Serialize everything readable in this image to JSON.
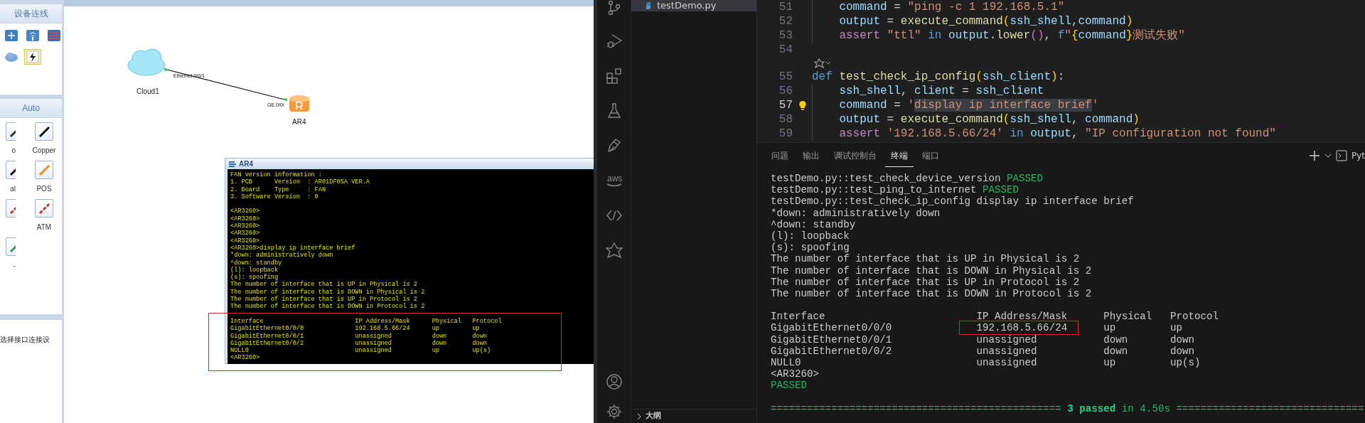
{
  "ensp": {
    "device_panel": {
      "title": "设备连线",
      "devices": [
        {
          "kind": "switch",
          "selected": false
        },
        {
          "kind": "wireless",
          "selected": false
        },
        {
          "kind": "firewall",
          "selected": false
        },
        {
          "kind": "cloud",
          "selected": false
        },
        {
          "kind": "bolt",
          "selected": true
        }
      ]
    },
    "links_panel": {
      "title": "Auto",
      "links": [
        {
          "kind": "auto",
          "label": "o"
        },
        {
          "kind": "copper",
          "label": "Copper"
        },
        {
          "kind": "serial",
          "label": "al"
        },
        {
          "kind": "pos",
          "label": "POS"
        },
        {
          "kind": "e1"
        },
        {
          "kind": "atm",
          "label": "ATM"
        },
        {
          "kind": "ctl",
          "label": "-"
        }
      ]
    },
    "hint": "选择接口连接设",
    "topology": {
      "nodes": [
        {
          "kind": "cloud",
          "label": "Cloud1"
        },
        {
          "kind": "router",
          "label": "AR4"
        }
      ],
      "link": {
        "from_port": "Ethernet 0/0/1",
        "to_port": "GE 0/0/"
      }
    },
    "console": {
      "title": "AR4",
      "lines": [
        {
          "kind": "text",
          "t": "FAN version information :"
        },
        {
          "kind": "text",
          "t": "1. PCB      Version  : AR01DF05A VER.A"
        },
        {
          "kind": "text",
          "t": "2. Board    Type     : FAN"
        },
        {
          "kind": "text",
          "t": "3. Software Version  : 0"
        },
        {
          "kind": "blank"
        },
        {
          "kind": "text",
          "t": "<AR3260>"
        },
        {
          "kind": "text",
          "t": "<AR3260>"
        },
        {
          "kind": "text",
          "t": "<AR3260>"
        },
        {
          "kind": "text",
          "t": "<AR3260>"
        },
        {
          "kind": "text",
          "t": "<AR3260>"
        },
        {
          "kind": "text",
          "t": "<AR3260>display ip interface brief"
        },
        {
          "kind": "text",
          "t": "*down: administratively down"
        },
        {
          "kind": "text",
          "t": "^down: standby"
        },
        {
          "kind": "text",
          "t": "(l): loopback"
        },
        {
          "kind": "text",
          "t": "(s): spoofing"
        },
        {
          "kind": "text",
          "t": "The number of interface that is UP in Physical is 2"
        },
        {
          "kind": "text",
          "t": "The number of interface that is DOWN in Physical is 2"
        },
        {
          "kind": "text",
          "t": "The number of interface that is UP in Protocol is 2"
        },
        {
          "kind": "text",
          "t": "The number of interface that is DOWN in Protocol is 2"
        },
        {
          "kind": "blank"
        }
      ],
      "table": {
        "highlighted": true,
        "rows": [
          [
            "Interface",
            "IP Address/Mask",
            "Physical",
            "Protocol"
          ],
          [
            "GigabitEthernet0/0/0",
            "192.168.5.66/24",
            "up",
            "up"
          ],
          [
            "GigabitEthernet0/0/1",
            "unassigned",
            "down",
            "down"
          ],
          [
            "GigabitEthernet0/0/2",
            "unassigned",
            "down",
            "down"
          ],
          [
            "NULL0",
            "unassigned",
            "up",
            "up(s)"
          ]
        ]
      },
      "prompt": "<AR3260>"
    }
  },
  "vscode": {
    "activity_bar": [
      {
        "kind": "source-control"
      },
      {
        "kind": "run-debug"
      },
      {
        "kind": "extensions"
      },
      {
        "kind": "testing"
      },
      {
        "kind": "plugin"
      },
      {
        "kind": "aws",
        "label": "aws"
      },
      {
        "kind": "code-link"
      },
      {
        "kind": "star"
      },
      {
        "kind": "account"
      },
      {
        "kind": "settings"
      }
    ],
    "explorer": {
      "files": [
        {
          "name": "testDemo.py",
          "selected": true
        }
      ],
      "outline": {
        "title": "大纲",
        "expanded": false
      }
    },
    "editor": {
      "lines": [
        {
          "number": "51",
          "indented": true,
          "tokens": [
            {
              "kind": "var",
              "t": "command"
            },
            {
              "kind": "p",
              "t": " = "
            },
            {
              "kind": "str",
              "t": "\"ping -c 1 192.168.5.1\""
            }
          ]
        },
        {
          "number": "52",
          "indented": true,
          "tokens": [
            {
              "kind": "var",
              "t": "output"
            },
            {
              "kind": "p",
              "t": " = "
            },
            {
              "kind": "fn",
              "t": "execute_command"
            },
            {
              "kind": "br",
              "t": "("
            },
            {
              "kind": "var",
              "t": "ssh_shell"
            },
            {
              "kind": "p",
              "t": ","
            },
            {
              "kind": "var",
              "t": "command"
            },
            {
              "kind": "br",
              "t": ")"
            }
          ]
        },
        {
          "number": "53",
          "indented": true,
          "tokens": [
            {
              "kind": "ctrl",
              "t": "assert "
            },
            {
              "kind": "str",
              "t": "\"ttl\" "
            },
            {
              "kind": "kw",
              "t": "in "
            },
            {
              "kind": "var",
              "t": "output"
            },
            {
              "kind": "p",
              "t": "."
            },
            {
              "kind": "fn",
              "t": "lower"
            },
            {
              "kind": "br2",
              "t": "()"
            },
            {
              "kind": "p",
              "t": ", "
            },
            {
              "kind": "kw",
              "t": "f"
            },
            {
              "kind": "str",
              "t": "\""
            },
            {
              "kind": "br",
              "t": "{"
            },
            {
              "kind": "var",
              "t": "command"
            },
            {
              "kind": "br",
              "t": "}"
            },
            {
              "kind": "str",
              "t": "测试失败\""
            }
          ]
        },
        {
          "number": "54"
        },
        {
          "kind": "codelens"
        },
        {
          "number": "55",
          "tokens": [
            {
              "kind": "kw",
              "t": "def "
            },
            {
              "kind": "fn",
              "t": "test_check_ip_config"
            },
            {
              "kind": "br",
              "t": "("
            },
            {
              "kind": "var",
              "t": "ssh_client"
            },
            {
              "kind": "br",
              "t": ")"
            },
            {
              "kind": "p",
              "t": ":"
            }
          ]
        },
        {
          "number": "56",
          "indented": true,
          "tokens": [
            {
              "kind": "var",
              "t": "ssh_shell"
            },
            {
              "kind": "p",
              "t": ", "
            },
            {
              "kind": "var",
              "t": "client"
            },
            {
              "kind": "p",
              "t": " = "
            },
            {
              "kind": "var",
              "t": "ssh_client"
            }
          ]
        },
        {
          "number": "57",
          "indented": true,
          "active": true,
          "lightbulb": true,
          "tokens": [
            {
              "kind": "var",
              "t": "command"
            },
            {
              "kind": "p",
              "t": " = "
            },
            {
              "kind": "str",
              "t": "'"
            },
            {
              "kind": "str",
              "t": "display ip interface brief",
              "selected": true
            },
            {
              "kind": "str",
              "t": "'"
            }
          ]
        },
        {
          "number": "58",
          "indented": true,
          "tokens": [
            {
              "kind": "var",
              "t": "output"
            },
            {
              "kind": "p",
              "t": " = "
            },
            {
              "kind": "fn",
              "t": "execute_command"
            },
            {
              "kind": "br",
              "t": "("
            },
            {
              "kind": "var",
              "t": "ssh_shell"
            },
            {
              "kind": "p",
              "t": ", "
            },
            {
              "kind": "var",
              "t": "command"
            },
            {
              "kind": "br",
              "t": ")"
            }
          ]
        },
        {
          "number": "59",
          "indented": true,
          "tokens": [
            {
              "kind": "ctrl",
              "t": "assert "
            },
            {
              "kind": "str",
              "t": "'192.168.5.66/24' "
            },
            {
              "kind": "kw",
              "t": "in "
            },
            {
              "kind": "var",
              "t": "output"
            },
            {
              "kind": "p",
              "t": ", "
            },
            {
              "kind": "str",
              "t": "\"IP configuration not found\""
            }
          ]
        }
      ]
    },
    "panel": {
      "tabs": [
        {
          "label": "问题",
          "selected": false
        },
        {
          "label": "输出",
          "selected": false
        },
        {
          "label": "调试控制台",
          "selected": false
        },
        {
          "label": "终端",
          "selected": true
        },
        {
          "label": "端口",
          "selected": false
        }
      ],
      "shell_label": "Pyt",
      "terminal": [
        {
          "kind": "text",
          "tokens": [
            {
              "kind": "plain",
              "t": "testDemo.py::test_check_device_version "
            },
            {
              "kind": "pass",
              "t": "PASSED"
            }
          ]
        },
        {
          "kind": "text",
          "tokens": [
            {
              "kind": "plain",
              "t": "testDemo.py::test_ping_to_internet "
            },
            {
              "kind": "pass",
              "t": "PASSED"
            }
          ]
        },
        {
          "kind": "text",
          "tokens": [
            {
              "kind": "plain",
              "t": "testDemo.py::test_check_ip_config display ip interface brief"
            }
          ]
        },
        {
          "kind": "text",
          "tokens": [
            {
              "kind": "plain",
              "t": "*down: administratively down"
            }
          ]
        },
        {
          "kind": "text",
          "tokens": [
            {
              "kind": "plain",
              "t": "^down: standby"
            }
          ]
        },
        {
          "kind": "text",
          "tokens": [
            {
              "kind": "plain",
              "t": "(l): loopback"
            }
          ]
        },
        {
          "kind": "text",
          "tokens": [
            {
              "kind": "plain",
              "t": "(s): spoofing"
            }
          ]
        },
        {
          "kind": "text",
          "tokens": [
            {
              "kind": "plain",
              "t": "The number of interface that is UP in Physical is 2"
            }
          ]
        },
        {
          "kind": "text",
          "tokens": [
            {
              "kind": "plain",
              "t": "The number of interface that is DOWN in Physical is 2"
            }
          ]
        },
        {
          "kind": "text",
          "tokens": [
            {
              "kind": "plain",
              "t": "The number of interface that is UP in Protocol is 2"
            }
          ]
        },
        {
          "kind": "text",
          "tokens": [
            {
              "kind": "plain",
              "t": "The number of interface that is DOWN in Protocol is 2"
            }
          ]
        },
        {
          "kind": "blank"
        },
        {
          "kind": "row",
          "cells": [
            {
              "t": "Interface"
            },
            {
              "t": "IP Address/Mask"
            },
            {
              "t": "Physical"
            },
            {
              "t": "Protocol"
            }
          ]
        },
        {
          "kind": "row",
          "cells": [
            {
              "t": "GigabitEthernet0/0/0"
            },
            {
              "t": "192.168.5.66/24",
              "boxed": true
            },
            {
              "t": "up"
            },
            {
              "t": "up"
            }
          ]
        },
        {
          "kind": "row",
          "cells": [
            {
              "t": "GigabitEthernet0/0/1"
            },
            {
              "t": "unassigned"
            },
            {
              "t": "down"
            },
            {
              "t": "down"
            }
          ]
        },
        {
          "kind": "row",
          "cells": [
            {
              "t": "GigabitEthernet0/0/2"
            },
            {
              "t": "unassigned"
            },
            {
              "t": "down"
            },
            {
              "t": "down"
            }
          ]
        },
        {
          "kind": "row",
          "cells": [
            {
              "t": "NULL0"
            },
            {
              "t": "unassigned"
            },
            {
              "t": "up"
            },
            {
              "t": "up(s)"
            }
          ]
        },
        {
          "kind": "text",
          "tokens": [
            {
              "kind": "plain",
              "t": "<AR3260>"
            }
          ]
        },
        {
          "kind": "text",
          "tokens": [
            {
              "kind": "pass",
              "t": "PASSED"
            }
          ]
        },
        {
          "kind": "blank"
        },
        {
          "kind": "text",
          "tokens": [
            {
              "kind": "pass",
              "t": "================================================ "
            },
            {
              "kind": "pass-bold",
              "t": "3 passed"
            },
            {
              "kind": "pass",
              "t": " in 4.50s ==============================="
            }
          ]
        }
      ]
    }
  }
}
